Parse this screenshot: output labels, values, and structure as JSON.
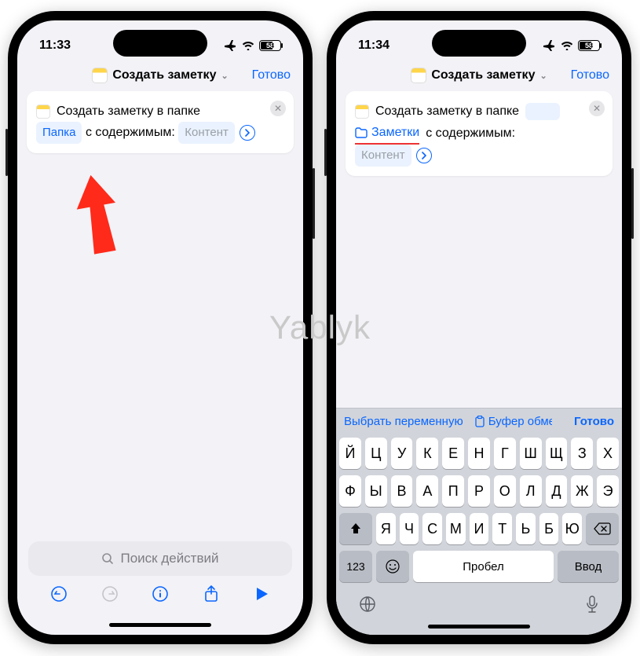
{
  "watermark": "Yablyk",
  "phone1": {
    "status": {
      "time": "11:33",
      "battery": "58"
    },
    "nav": {
      "title": "Создать заметку",
      "done": "Готово"
    },
    "card": {
      "prefix": "Создать заметку в папке",
      "folder_token": "Папка",
      "with_text": "с содержимым:",
      "content_token": "Контент"
    },
    "search_placeholder": "Поиск действий"
  },
  "phone2": {
    "status": {
      "time": "11:34",
      "battery": "58"
    },
    "nav": {
      "title": "Создать заметку",
      "done": "Готово"
    },
    "card": {
      "prefix": "Создать заметку в папке",
      "folder_label": "Заметки",
      "with_text": "с содержимым:",
      "content_token": "Контент"
    },
    "kbd_toolbar": {
      "pick_var": "Выбрать переменную",
      "clipboard": "Буфер обмен",
      "done": "Готово"
    },
    "keyboard": {
      "row1": [
        "Й",
        "Ц",
        "У",
        "К",
        "Е",
        "Н",
        "Г",
        "Ш",
        "Щ",
        "З",
        "Х"
      ],
      "row2": [
        "Ф",
        "Ы",
        "В",
        "А",
        "П",
        "Р",
        "О",
        "Л",
        "Д",
        "Ж",
        "Э"
      ],
      "row3": [
        "Я",
        "Ч",
        "С",
        "М",
        "И",
        "Т",
        "Ь",
        "Б",
        "Ю"
      ],
      "num": "123",
      "space": "Пробел",
      "enter": "Ввод"
    }
  }
}
